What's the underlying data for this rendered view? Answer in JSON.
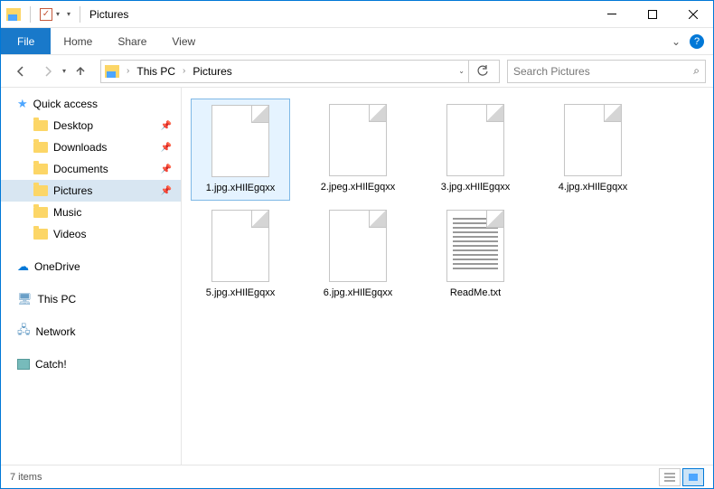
{
  "titlebar": {
    "title": "Pictures"
  },
  "ribbon": {
    "file": "File",
    "tabs": [
      "Home",
      "Share",
      "View"
    ]
  },
  "breadcrumb": [
    "This PC",
    "Pictures"
  ],
  "search": {
    "placeholder": "Search Pictures"
  },
  "sidebar": {
    "quick_access": "Quick access",
    "quick_items": [
      {
        "label": "Desktop",
        "pinned": true
      },
      {
        "label": "Downloads",
        "pinned": true
      },
      {
        "label": "Documents",
        "pinned": true
      },
      {
        "label": "Pictures",
        "pinned": true,
        "selected": true
      },
      {
        "label": "Music",
        "pinned": false
      },
      {
        "label": "Videos",
        "pinned": false
      }
    ],
    "onedrive": "OneDrive",
    "this_pc": "This PC",
    "network": "Network",
    "catch": "Catch!"
  },
  "files": [
    {
      "name": "1.jpg.xHIlEgqxx",
      "type": "unknown",
      "selected": true
    },
    {
      "name": "2.jpeg.xHIlEgqxx",
      "type": "unknown"
    },
    {
      "name": "3.jpg.xHIlEgqxx",
      "type": "unknown"
    },
    {
      "name": "4.jpg.xHIlEgqxx",
      "type": "unknown"
    },
    {
      "name": "5.jpg.xHIlEgqxx",
      "type": "unknown"
    },
    {
      "name": "6.jpg.xHIlEgqxx",
      "type": "unknown"
    },
    {
      "name": "ReadMe.txt",
      "type": "txt"
    }
  ],
  "status": {
    "count": "7 items"
  }
}
